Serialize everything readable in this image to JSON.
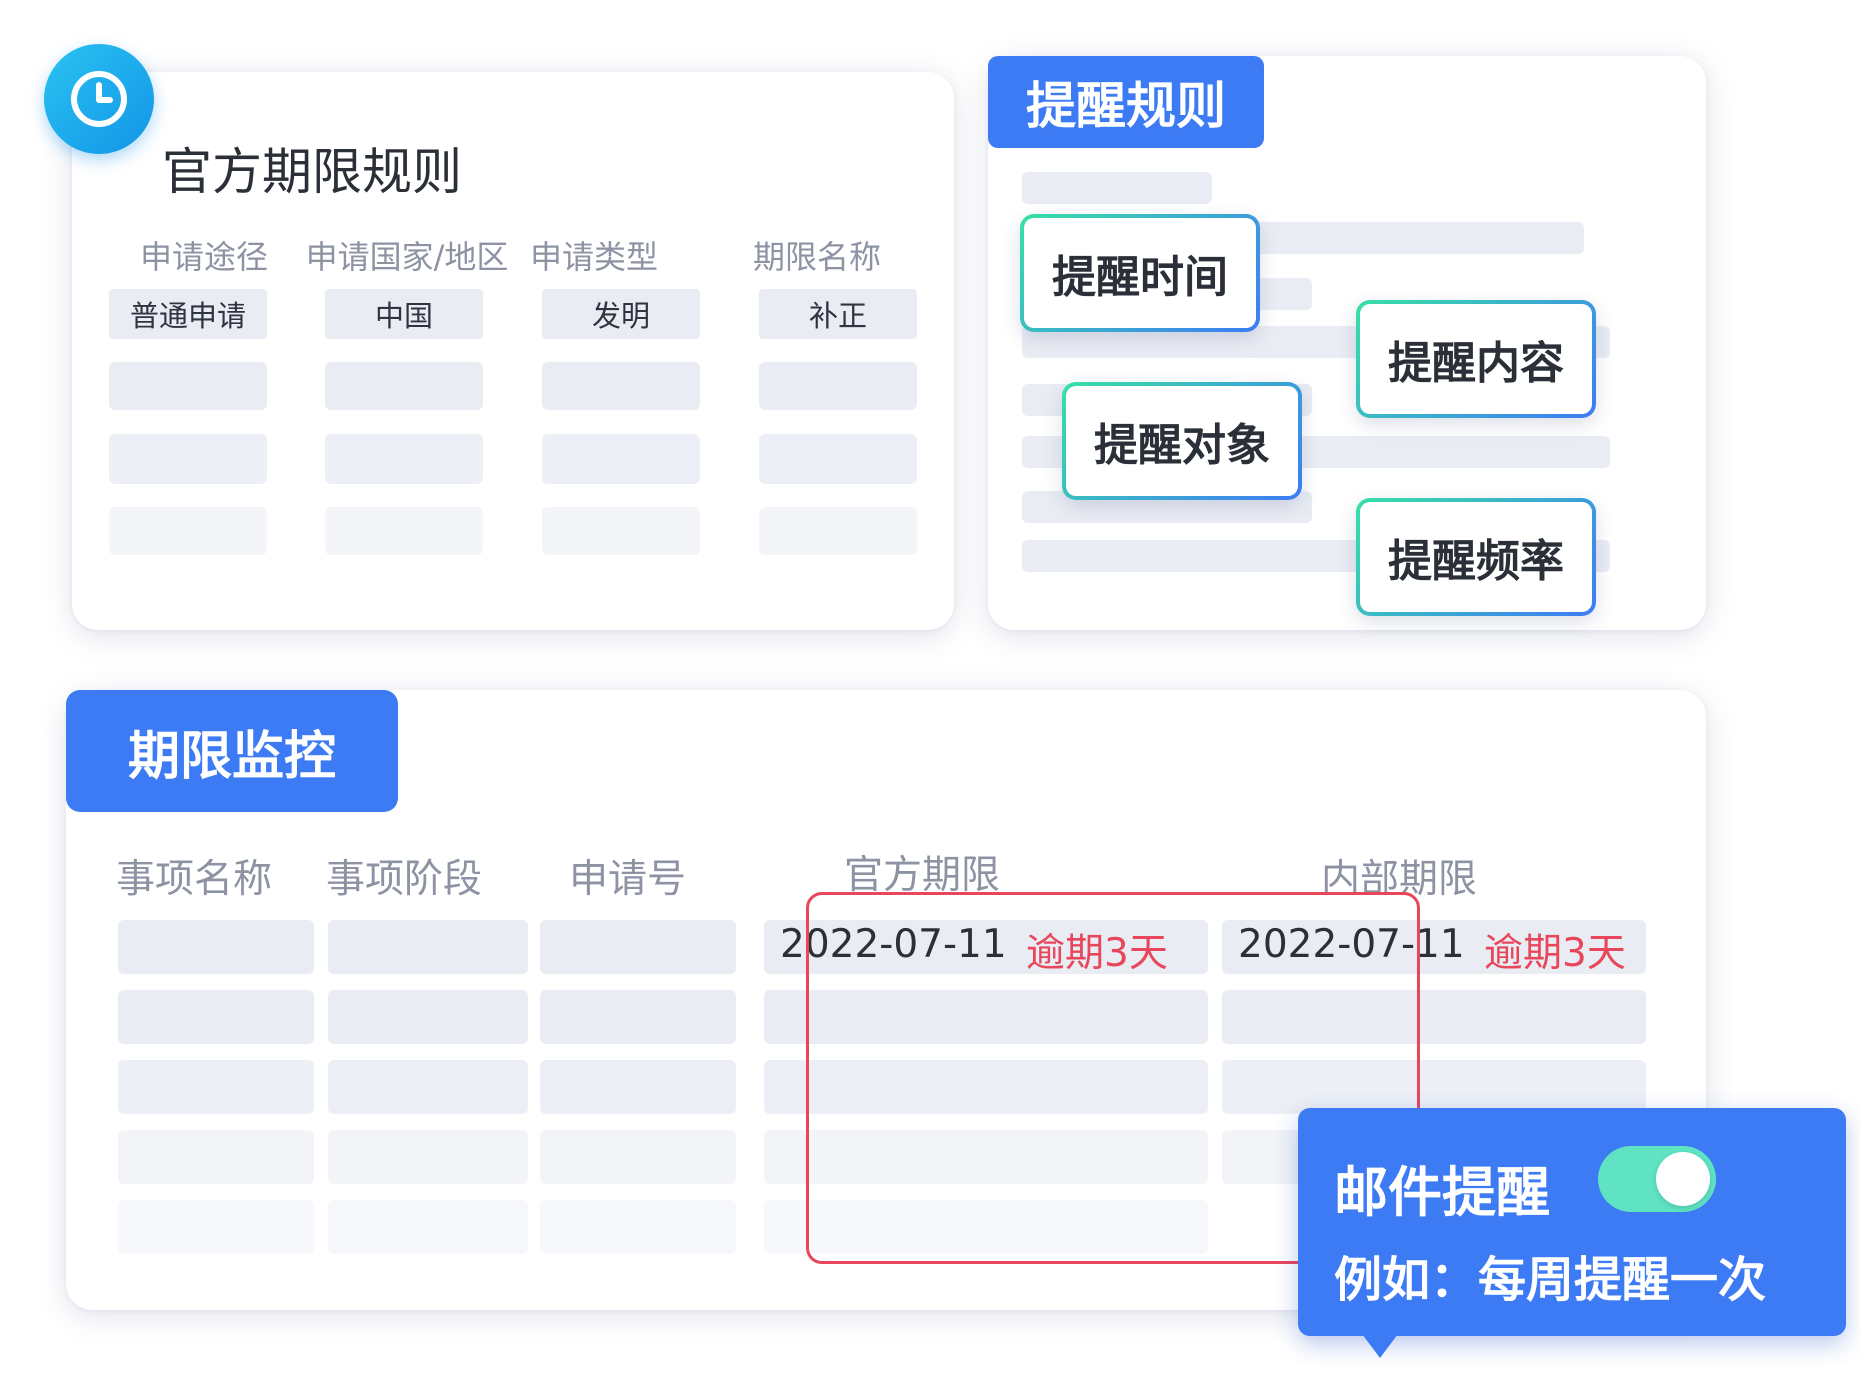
{
  "official_rules": {
    "title": "官方期限规则",
    "columns": [
      "申请途径",
      "申请国家/地区",
      "申请类型",
      "期限名称"
    ],
    "first_row": [
      "普通申请",
      "中国",
      "发明",
      "补正"
    ]
  },
  "reminder_rules": {
    "tag": "提醒规则",
    "items": [
      "提醒时间",
      "提醒内容",
      "提醒对象",
      "提醒频率"
    ]
  },
  "deadline_monitor": {
    "tag": "期限监控",
    "columns": [
      "事项名称",
      "事项阶段",
      "申请号",
      "官方期限",
      "内部期限"
    ],
    "official_deadline": {
      "date": "2022-07-11",
      "status": "逾期3天"
    },
    "internal_deadline": {
      "date": "2022-07-11",
      "status": "逾期3天"
    }
  },
  "email_popup": {
    "title": "邮件提醒",
    "toggle_on": true,
    "example": "例如：每周提醒一次"
  },
  "colors": {
    "accent_blue": "#3d7bf5",
    "clock_badge": "#1aa7ec",
    "overdue_red": "#e8475b",
    "toggle_green": "#5fe3c3",
    "placeholder_gray": "#e9ecf3"
  },
  "icons": [
    "clock-icon"
  ]
}
